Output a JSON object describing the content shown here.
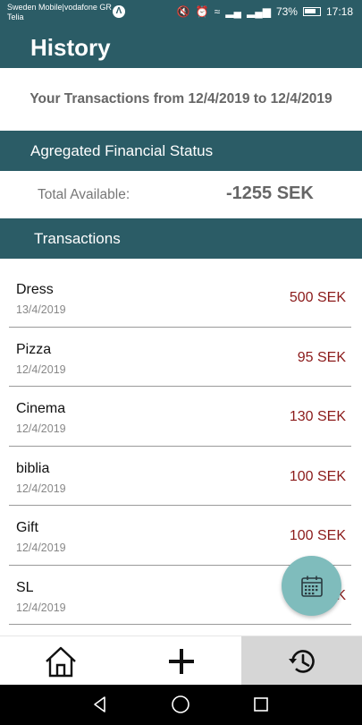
{
  "status_bar": {
    "carrier_line1": "Sweden Mobile|vodafone GR",
    "carrier_line2": "Telia",
    "battery": "73%",
    "time": "17:18"
  },
  "app_bar": {
    "title": "History"
  },
  "period_text": "Your Transactions from 12/4/2019 to 12/4/2019",
  "aggregated": {
    "header": "Agregated Financial Status",
    "total_label": "Total Available:",
    "total_value": "-1255 SEK"
  },
  "transactions": {
    "header": "Transactions",
    "items": [
      {
        "name": "Dress",
        "date": "13/4/2019",
        "amount": "500 SEK"
      },
      {
        "name": "Pizza",
        "date": "12/4/2019",
        "amount": "95 SEK"
      },
      {
        "name": "Cinema",
        "date": "12/4/2019",
        "amount": "130 SEK"
      },
      {
        "name": "biblia",
        "date": "12/4/2019",
        "amount": "100 SEK"
      },
      {
        "name": "Gift",
        "date": "12/4/2019",
        "amount": "100 SEK"
      },
      {
        "name": "SL",
        "date": "12/4/2019",
        "amount": "K"
      }
    ]
  },
  "fab": {
    "icon": "calendar-icon"
  },
  "bottom_nav": {
    "items": [
      {
        "icon": "home-icon"
      },
      {
        "icon": "add-icon"
      },
      {
        "icon": "history-icon",
        "selected": true
      }
    ]
  },
  "colors": {
    "primary": "#2b5c66",
    "amount": "#8b1a1a",
    "fab": "#7fbcbc",
    "nav_selected": "#d6d6d6"
  }
}
